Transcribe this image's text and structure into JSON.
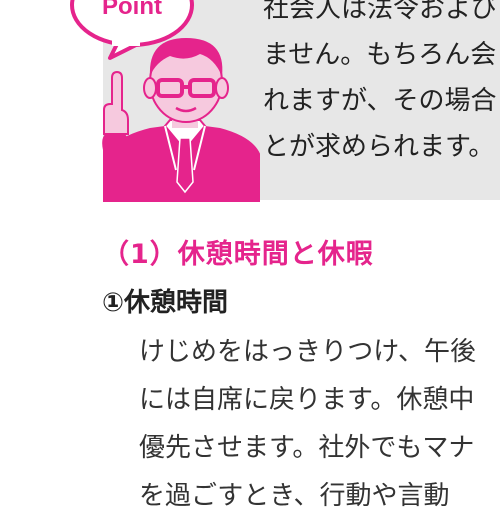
{
  "callout": {
    "badge_label": "Point",
    "lines": [
      "社会人は法令および",
      "ません。もちろん会",
      "れますが、その場合",
      "とが求められます。"
    ]
  },
  "section": {
    "heading": "（1）休憩時間と休暇",
    "subheading": "①休憩時間",
    "lines": [
      "けじめをはっきりつけ、午後",
      "には自席に戻ります。休憩中",
      "優先させます。社外でもマナ",
      "を過ごすとき、行動や言動"
    ]
  },
  "colors": {
    "accent": "#e5248c",
    "callout_bg": "#e7e7e7",
    "text": "#222222"
  }
}
